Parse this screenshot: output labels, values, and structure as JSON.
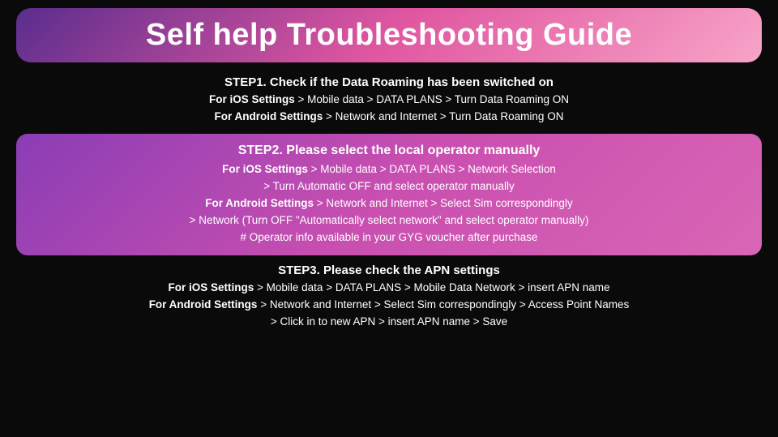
{
  "title": "Self help Troubleshooting Guide",
  "step1": {
    "heading": "STEP1. Check if the Data Roaming has been switched on",
    "line1_bold": "For iOS Settings",
    "line1_rest": " > Mobile data > DATA PLANS > Turn Data Roaming ON",
    "line2_bold": "For Android Settings",
    "line2_rest": " > Network and Internet > Turn Data Roaming ON"
  },
  "step2": {
    "heading": "STEP2. Please select the local operator manually",
    "line1_bold": "For iOS Settings",
    "line1_rest": " > Mobile data > DATA PLANS > Network Selection",
    "line2": "> Turn Automatic OFF and select operator manually",
    "line3_bold": "For Android Settings",
    "line3_rest": " > Network and Internet > Select Sim correspondingly",
    "line4": "> Network (Turn OFF \"Automatically select network\" and select operator manually)",
    "line5": "# Operator info available in your GYG voucher after purchase"
  },
  "step3": {
    "heading": "STEP3. Please check the APN settings",
    "line1_bold": "For iOS Settings",
    "line1_rest": " > Mobile data > DATA PLANS > Mobile Data Network > insert APN name",
    "line2_bold": "For Android Settings",
    "line2_rest": " > Network and Internet > Select Sim correspondingly > Access Point Names",
    "line3": "> Click in to new APN > insert APN name > Save"
  }
}
